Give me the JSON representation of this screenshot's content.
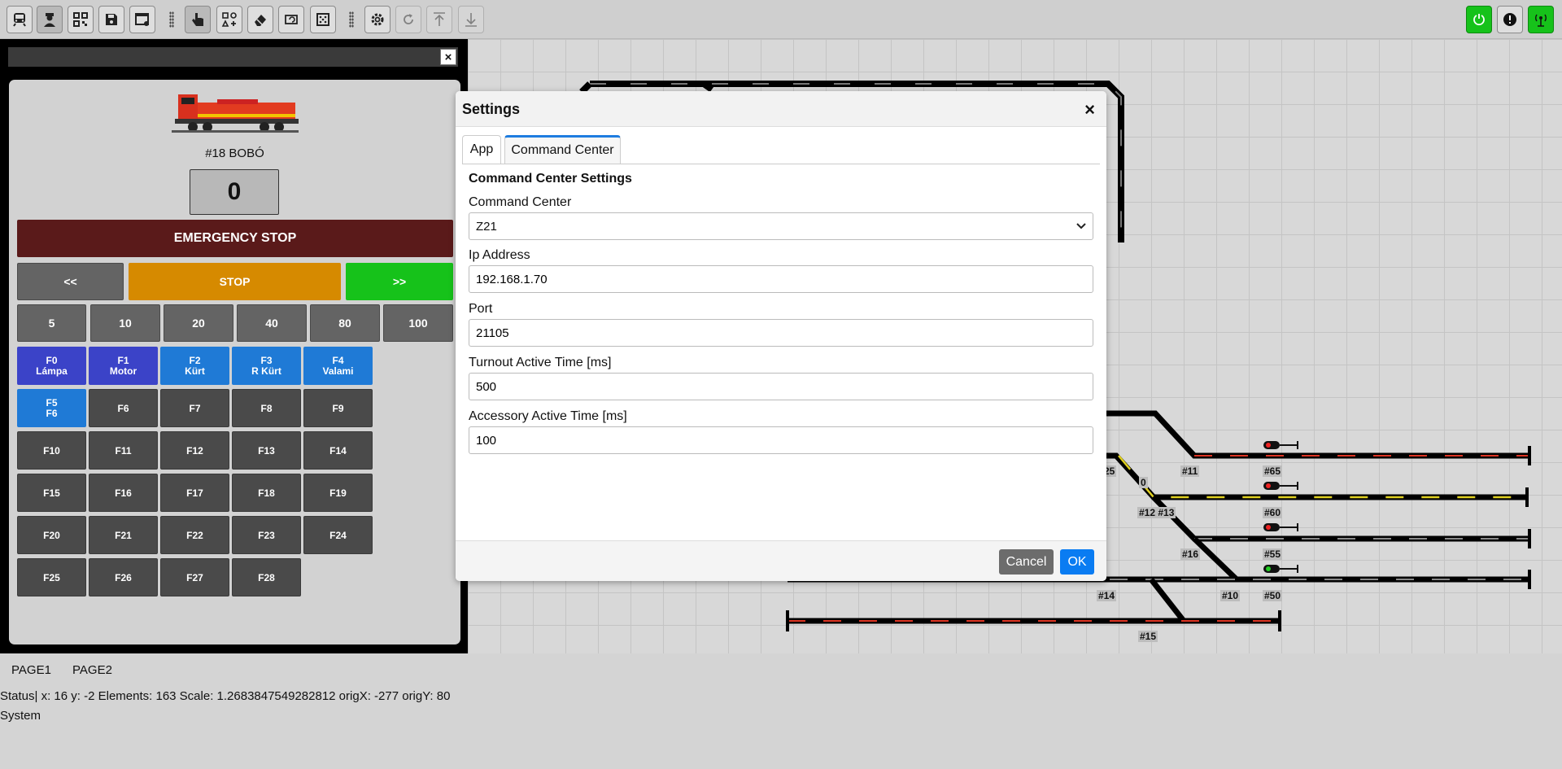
{
  "toolbar": {
    "left_icons": [
      "train-icon",
      "engineer-icon",
      "qr-icon",
      "save-icon",
      "window-settings-icon",
      "hand-pointer-icon",
      "add-shapes-icon",
      "eraser-icon",
      "rotate-box-icon",
      "dice-icon",
      "gear-icon",
      "refresh-icon",
      "arrow-up-icon",
      "arrow-down-icon"
    ],
    "right_icons": [
      "power-icon",
      "alert-icon",
      "antenna-icon"
    ],
    "accent_green": "#16c21a"
  },
  "throttle": {
    "loco_name": "#18 BOBÓ",
    "speed": "0",
    "emergency_stop": "EMERGENCY STOP",
    "rev": "<<",
    "stop": "STOP",
    "fwd": ">>",
    "speed_steps": [
      "5",
      "10",
      "20",
      "40",
      "80",
      "100"
    ],
    "functions": [
      {
        "l1": "F0",
        "l2": "Lámpa"
      },
      {
        "l1": "F1",
        "l2": "Motor"
      },
      {
        "l1": "F2",
        "l2": "Kürt"
      },
      {
        "l1": "F3",
        "l2": "R Kürt"
      },
      {
        "l1": "F4",
        "l2": "Valami"
      },
      {
        "l1": "F5",
        "l2": "F6"
      },
      {
        "l1": "F6",
        "l2": ""
      },
      {
        "l1": "F7",
        "l2": ""
      },
      {
        "l1": "F8",
        "l2": ""
      },
      {
        "l1": "F9",
        "l2": ""
      },
      {
        "l1": "F10",
        "l2": ""
      },
      {
        "l1": "F11",
        "l2": ""
      },
      {
        "l1": "F12",
        "l2": ""
      },
      {
        "l1": "F13",
        "l2": ""
      },
      {
        "l1": "F14",
        "l2": ""
      },
      {
        "l1": "F15",
        "l2": ""
      },
      {
        "l1": "F16",
        "l2": ""
      },
      {
        "l1": "F17",
        "l2": ""
      },
      {
        "l1": "F18",
        "l2": ""
      },
      {
        "l1": "F19",
        "l2": ""
      },
      {
        "l1": "F20",
        "l2": ""
      },
      {
        "l1": "F21",
        "l2": ""
      },
      {
        "l1": "F22",
        "l2": ""
      },
      {
        "l1": "F23",
        "l2": ""
      },
      {
        "l1": "F24",
        "l2": ""
      },
      {
        "l1": "F25",
        "l2": ""
      },
      {
        "l1": "F26",
        "l2": ""
      },
      {
        "l1": "F27",
        "l2": ""
      },
      {
        "l1": "F28",
        "l2": ""
      }
    ]
  },
  "track_labels": [
    "#11",
    "#65",
    "25",
    "0",
    "#12 #13",
    "#60",
    "#16",
    "#55",
    "#14",
    "#10",
    "#50",
    "#15"
  ],
  "pages": [
    "PAGE1",
    "PAGE2"
  ],
  "status": {
    "line1": "Status| x: 16 y: -2 Elements: 163 Scale: 1.2683847549282812 origX: -277 origY: 80",
    "line2": "System"
  },
  "dialog": {
    "title": "Settings",
    "close": "×",
    "tabs": [
      "App",
      "Command Center"
    ],
    "section": "Command Center Settings",
    "cc_label": "Command Center",
    "cc_value": "Z21",
    "ip_label": "Ip Address",
    "ip_value": "192.168.1.70",
    "port_label": "Port",
    "port_value": "21105",
    "turnout_label": "Turnout Active Time [ms]",
    "turnout_value": "500",
    "accessory_label": "Accessory Active Time [ms]",
    "accessory_value": "100",
    "cancel": "Cancel",
    "ok": "OK"
  }
}
